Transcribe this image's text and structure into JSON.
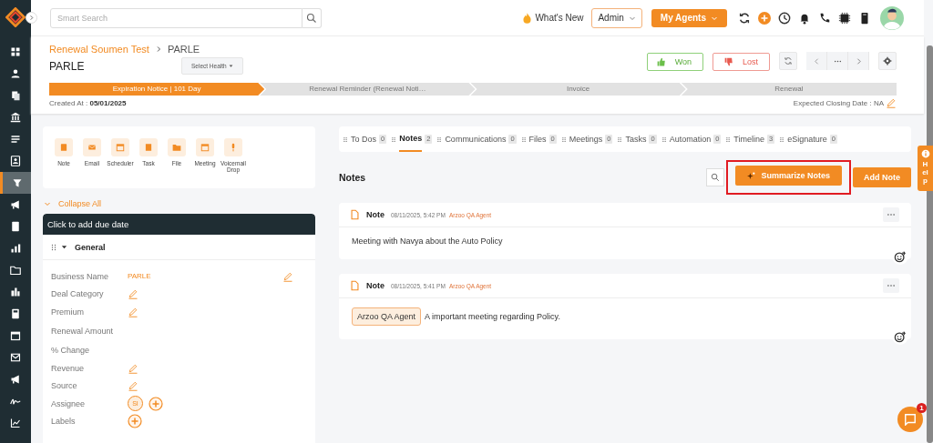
{
  "sidebar": {
    "items": [
      {
        "selected": false
      },
      {
        "selected": false
      },
      {
        "selected": false
      },
      {
        "selected": false
      },
      {
        "selected": false
      },
      {
        "selected": false
      },
      {
        "selected": true
      },
      {
        "selected": false
      },
      {
        "selected": false
      },
      {
        "selected": false
      },
      {
        "selected": false
      },
      {
        "selected": false
      },
      {
        "selected": false
      },
      {
        "selected": false
      },
      {
        "selected": false
      },
      {
        "selected": false
      },
      {
        "selected": false
      },
      {
        "selected": false
      }
    ]
  },
  "topbar": {
    "search": {
      "placeholder": "Smart Search"
    },
    "whats_new": "What's New",
    "role": "Admin",
    "agents": "My Agents"
  },
  "header": {
    "breadcrumb": [
      "Renewal Soumen Test",
      "PARLE"
    ],
    "title": "PARLE",
    "health": "Select Health",
    "won": "Won",
    "lost": "Lost",
    "stages": [
      {
        "label": "Expiration Notice | 101 Day",
        "selected": true
      },
      {
        "label": "Renewal Reminder (Renewal Noti…",
        "selected": false
      },
      {
        "label": "Invoice",
        "selected": false
      },
      {
        "label": "Renewal",
        "selected": false
      }
    ],
    "created_label": "Created At :",
    "created_value": "05/01/2025",
    "expected": "Expected Closing Date : NA"
  },
  "actions": [
    "Note",
    "Email",
    "Scheduler",
    "Task",
    "File",
    "Meeting",
    "Voicemail Drop"
  ],
  "collapse": "Collapse All",
  "due_date": "Click to add due date",
  "section": "General",
  "fields": [
    {
      "label": "Business Name",
      "kind": "value",
      "value": "PARLE"
    },
    {
      "label": "Deal Category",
      "kind": "edit"
    },
    {
      "label": "Premium",
      "kind": "edit"
    },
    {
      "label": "Renewal Amount",
      "kind": "empty"
    },
    {
      "label": "% Change",
      "kind": "empty"
    },
    {
      "label": "Revenue",
      "kind": "edit"
    },
    {
      "label": "Source",
      "kind": "edit"
    },
    {
      "label": "Assignee",
      "kind": "assignee",
      "avatar": "SI"
    },
    {
      "label": "Labels",
      "kind": "add"
    }
  ],
  "tabs": [
    {
      "label": "To Dos",
      "count": "0",
      "selected": false
    },
    {
      "label": "Notes",
      "count": "2",
      "selected": true
    },
    {
      "label": "Communications",
      "count": "0",
      "selected": false
    },
    {
      "label": "Files",
      "count": "0",
      "selected": false
    },
    {
      "label": "Meetings",
      "count": "0",
      "selected": false
    },
    {
      "label": "Tasks",
      "count": "0",
      "selected": false
    },
    {
      "label": "Automation",
      "count": "0",
      "selected": false
    },
    {
      "label": "Timeline",
      "count": "3",
      "selected": false
    },
    {
      "label": "eSignature",
      "count": "0",
      "selected": false
    }
  ],
  "notes_title": "Notes",
  "summarize": "Summarize Notes",
  "add_note": "Add Note",
  "notes": [
    {
      "type": "Note",
      "time": "08/11/2025, 5:42 PM",
      "author": "Arzoo QA Agent",
      "body": "Meeting with Navya about the Auto Policy"
    },
    {
      "type": "Note",
      "time": "08/11/2025, 5:41 PM",
      "author": "Arzoo QA Agent",
      "mention": "Arzoo QA Agent",
      "body": "A important meeting regarding Policy."
    }
  ],
  "help": "Help",
  "chat_badge": "1"
}
